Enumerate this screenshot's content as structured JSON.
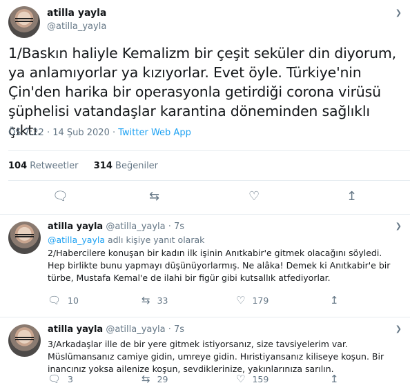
{
  "main": {
    "name": "atilla yayla",
    "handle": "@atilla_yayla",
    "text": "1/Baskın haliyle Kemalizm bir çeşit seküler din diyorum, ya anlamıyorlar ya kızıyorlar. Evet öyle. Türkiye'nin Çin'den harika bir operasyonla getirdiği corona virüsü şüphelisi vatandaşlar karantina döneminden sağlıklı çıktı.",
    "timestamp": "ÖS 7:22 · 14 Şub 2020 · ",
    "source": "Twitter Web App",
    "retweets_count": "104",
    "retweets_label": " Retweetler",
    "likes_count": "314",
    "likes_label": " Beğeniler"
  },
  "replies": [
    {
      "name": "atilla yayla",
      "handle_time": " @atilla_yayla · 7s",
      "reply_to_handle": "@atilla_yayla",
      "reply_to_suffix": " adlı kişiye yanıt olarak",
      "text": "2/Habercilere konuşan bir kadın ilk işinin Anıtkabir'e gitmek olacağını söyledi. Hep birlikte bunu yapmayı düşünüyorlarmış. Ne alâka! Demek ki Anıtkabir'e bir türbe, Mustafa Kemal'e de ilahi bir figür gibi kutsallık atfediyorlar.",
      "replies": "10",
      "retweets": "33",
      "likes": "179"
    },
    {
      "name": "atilla yayla",
      "handle_time": " @atilla_yayla · 7s",
      "text": "3/Arkadaşlar ille de bir yere gitmek istiyorsanız, size tavsiyelerim var. Müslümansanız camiye gidin, umreye gidin. Hıristiyansanız kiliseye koşun. Bir inancınız yoksa ailenize koşun, sevdiklerinize, yakınlarınıza sarılın.",
      "replies": "3",
      "retweets": "29",
      "likes": "159"
    }
  ],
  "icons": {
    "reply": "comment-icon",
    "retweet": "retweet-icon",
    "like": "heart-icon",
    "share": "share-icon",
    "more": "chevron-down-icon"
  },
  "colors": {
    "link": "#1da1f2",
    "secondary_text": "#657786",
    "divider": "#e6ecf0"
  }
}
